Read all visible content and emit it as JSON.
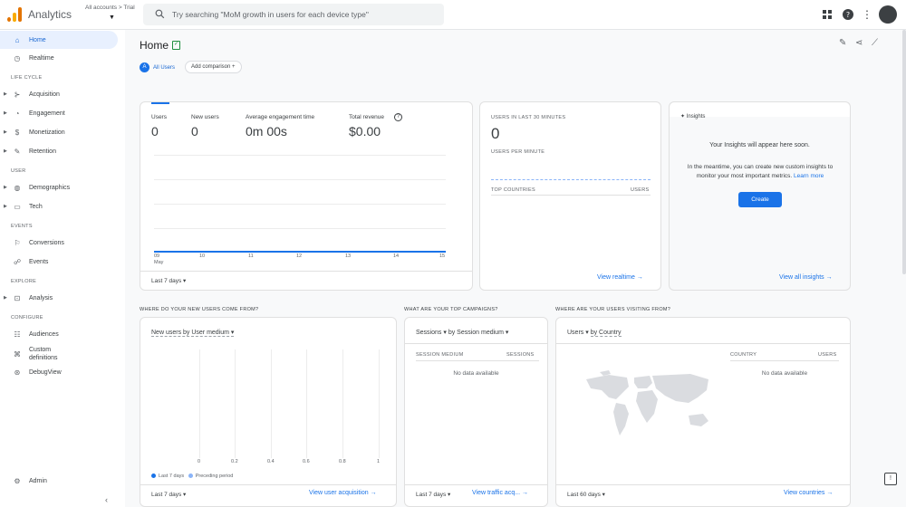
{
  "app": {
    "title": "Analytics",
    "account_breadcrumb": "All accounts > Trial"
  },
  "search": {
    "placeholder": "Try searching \"MoM growth in users for each device type\""
  },
  "sidebar": {
    "items_top": [
      {
        "label": "Home",
        "icon": "home-icon",
        "active": true
      },
      {
        "label": "Realtime",
        "icon": "clock-icon"
      }
    ],
    "sections": {
      "lifecycle": "LIFE CYCLE",
      "user": "USER",
      "events": "EVENTS",
      "explore": "EXPLORE",
      "configure": "CONFIGURE"
    },
    "lifecycle_items": [
      "Acquisition",
      "Engagement",
      "Monetization",
      "Retention"
    ],
    "user_items": [
      "Demographics",
      "Tech"
    ],
    "events_items": [
      "Conversions",
      "Events"
    ],
    "explore_items": [
      "Analysis"
    ],
    "configure_items": [
      "Audiences",
      "Custom definitions",
      "DebugView"
    ],
    "admin": "Admin"
  },
  "header": {
    "title": "Home",
    "chip_all_users": "All Users",
    "chip_all_initial": "A",
    "add_comparison": "Add comparison +"
  },
  "overview": {
    "metrics": [
      {
        "label": "Users",
        "value": "0"
      },
      {
        "label": "New users",
        "value": "0"
      },
      {
        "label": "Average engagement time",
        "value": "0m 00s"
      },
      {
        "label": "Total revenue",
        "value": "$0.00"
      }
    ],
    "x_ticks": [
      "09",
      "10",
      "11",
      "12",
      "13",
      "14",
      "15"
    ],
    "x_month": "May",
    "date_range": "Last 7 days"
  },
  "realtime": {
    "title": "USERS IN LAST 30 MINUTES",
    "value": "0",
    "per_minute": "USERS PER MINUTE",
    "col_countries": "TOP COUNTRIES",
    "col_users": "USERS",
    "link": "View realtime"
  },
  "insights": {
    "title": "Insights",
    "heading": "Your Insights will appear here soon.",
    "body": "In the meantime, you can create new custom insights to monitor your most important metrics.",
    "learn_more": "Learn more",
    "create": "Create",
    "link": "View all insights"
  },
  "acquisition": {
    "section": "WHERE DO YOUR NEW USERS COME FROM?",
    "dropdown": "New users by User medium",
    "x_ticks": [
      "0",
      "0.2",
      "0.4",
      "0.6",
      "0.8",
      "1"
    ],
    "legend_current": "Last 7 days",
    "legend_previous": "Preceding period",
    "date_range": "Last 7 days",
    "link": "View user acquisition",
    "colors": {
      "current": "#1a73e8",
      "previous": "#8ab4f8"
    }
  },
  "campaigns": {
    "section": "WHAT ARE YOUR TOP CAMPAIGNS?",
    "metric": "Sessions",
    "dimension": "by Session medium",
    "col1": "SESSION MEDIUM",
    "col2": "SESSIONS",
    "empty": "No data available",
    "date_range": "Last 7 days",
    "link": "View traffic acq..."
  },
  "geo": {
    "section": "WHERE ARE YOUR USERS VISITING FROM?",
    "metric": "Users",
    "dimension": "by Country",
    "col1": "COUNTRY",
    "col2": "USERS",
    "empty": "No data available",
    "date_range": "Last 60 days",
    "link": "View countries"
  }
}
